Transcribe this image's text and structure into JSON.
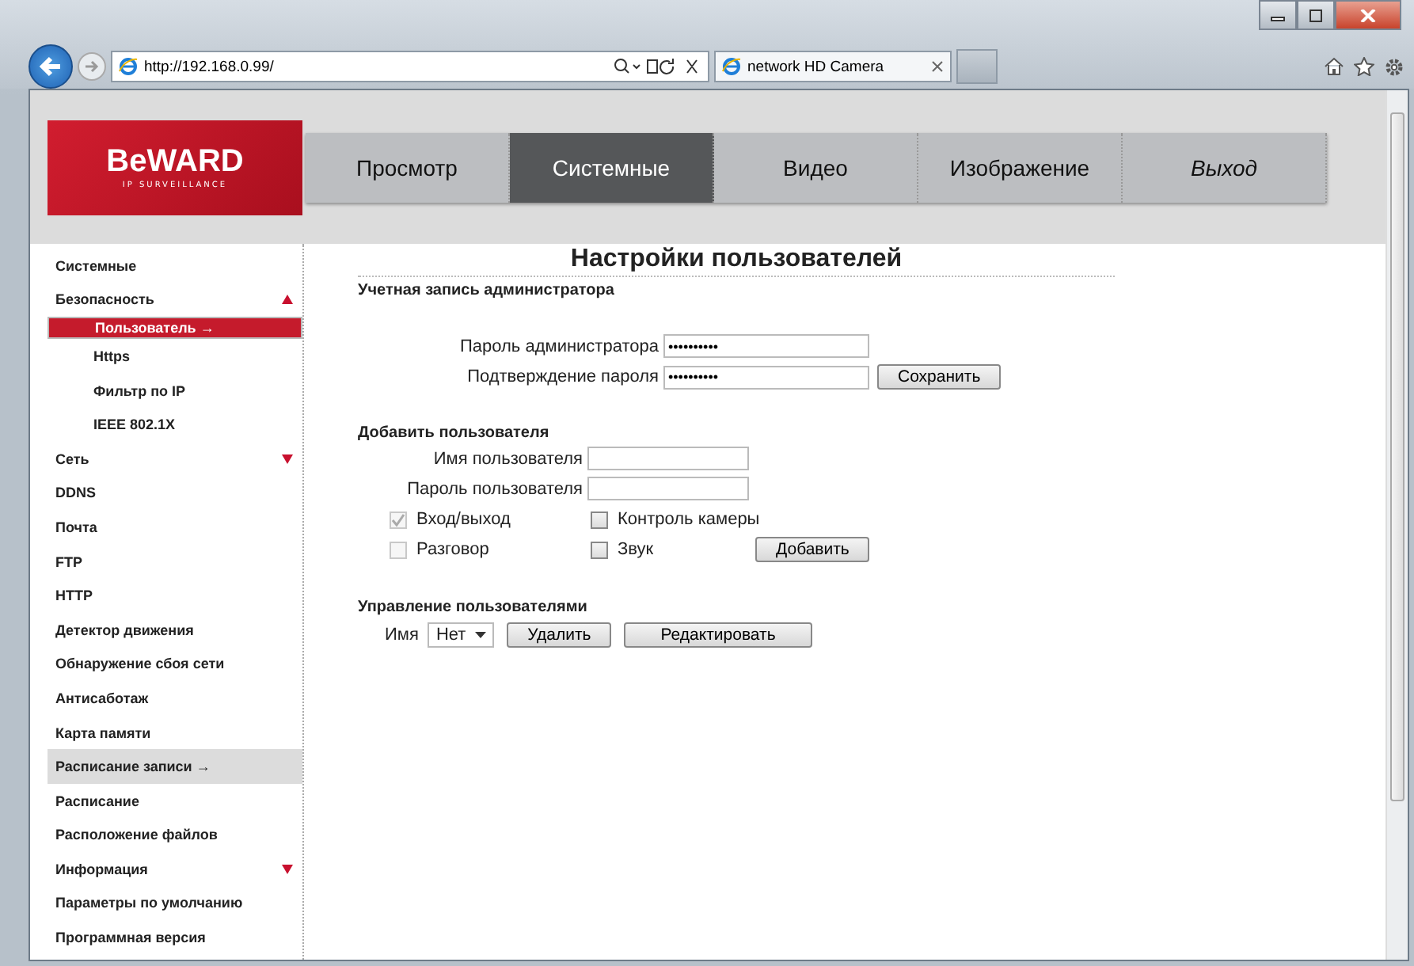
{
  "browser": {
    "address": "http://192.168.0.99/",
    "tab_title": "network HD Camera"
  },
  "logo": {
    "brand": "BeWARD",
    "tagline": "IP SURVEILLANCE"
  },
  "nav": [
    {
      "label": "Просмотр",
      "selected": false,
      "kind": "page"
    },
    {
      "label": "Системные",
      "selected": true,
      "kind": "page"
    },
    {
      "label": "Видео",
      "selected": false,
      "kind": "page"
    },
    {
      "label": "Изображение",
      "selected": false,
      "kind": "page"
    },
    {
      "label": "Выход",
      "selected": false,
      "kind": "logout"
    }
  ],
  "sidebar": {
    "items": [
      {
        "label": "Системные",
        "selected": false,
        "hovered": false
      },
      {
        "label": "Безопасность",
        "selected": false,
        "hovered": false,
        "expanded": true,
        "children": [
          {
            "label": "Пользователь",
            "pointer": "→",
            "selected": true,
            "hovered": false
          },
          {
            "label": "Https",
            "selected": false,
            "hovered": false
          },
          {
            "label": "Фильтр по IP",
            "selected": false,
            "hovered": false
          },
          {
            "label": "IEEE 802.1X",
            "selected": false,
            "hovered": false
          }
        ]
      },
      {
        "label": "Сеть",
        "selected": false,
        "hovered": false,
        "expanded": false
      },
      {
        "label": "DDNS",
        "selected": false,
        "hovered": false
      },
      {
        "label": "Почта",
        "selected": false,
        "hovered": false
      },
      {
        "label": "FTP",
        "selected": false,
        "hovered": false
      },
      {
        "label": "HTTP",
        "selected": false,
        "hovered": false
      },
      {
        "label": "Детектор движения",
        "selected": false,
        "hovered": false
      },
      {
        "label": "Обнаружение сбоя сети",
        "selected": false,
        "hovered": false
      },
      {
        "label": "Антисаботаж",
        "selected": false,
        "hovered": false
      },
      {
        "label": "Карта памяти",
        "selected": false,
        "hovered": false
      },
      {
        "label": "Расписание записи",
        "pointer": "→",
        "selected": false,
        "hovered": true
      },
      {
        "label": "Расписание",
        "selected": false,
        "hovered": false
      },
      {
        "label": "Расположение файлов",
        "selected": false,
        "hovered": false
      },
      {
        "label": "Информация",
        "selected": false,
        "hovered": false,
        "expanded": false
      },
      {
        "label": "Параметры по умолчанию",
        "selected": false,
        "hovered": false
      },
      {
        "label": "Программная версия",
        "selected": false,
        "hovered": false
      }
    ]
  },
  "page_title": "Настройки пользователей",
  "admin": {
    "heading": "Учетная запись администратора",
    "fields": [
      {
        "label": "Пароль администратора",
        "value": "••••••••••"
      },
      {
        "label": "Подтверждение пароля",
        "value": "••••••••••"
      }
    ],
    "button": "Сохранить"
  },
  "add_user": {
    "heading": "Добавить пользователя",
    "fields": [
      {
        "label": "Имя пользователя"
      },
      {
        "label": "Пароль пользователя"
      }
    ],
    "permissions": [
      {
        "label": "Вход/выход",
        "checked": true,
        "disabled": true
      },
      {
        "label": "Контроль камеры",
        "checked": false,
        "disabled": false
      },
      {
        "label": "Разговор",
        "checked": false,
        "disabled": true
      },
      {
        "label": "Звук",
        "checked": false,
        "disabled": false
      }
    ],
    "button": "Добавить"
  },
  "manage": {
    "heading": "Управление пользователями",
    "name_label": "Имя",
    "select_value": "Нет",
    "buttons": [
      "Удалить",
      "Редактировать"
    ]
  }
}
